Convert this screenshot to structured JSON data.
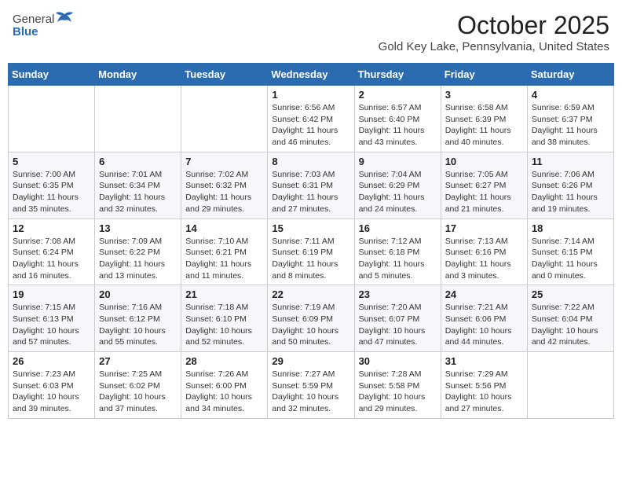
{
  "header": {
    "logo_general": "General",
    "logo_blue": "Blue",
    "month_year": "October 2025",
    "location": "Gold Key Lake, Pennsylvania, United States"
  },
  "days_of_week": [
    "Sunday",
    "Monday",
    "Tuesday",
    "Wednesday",
    "Thursday",
    "Friday",
    "Saturday"
  ],
  "weeks": [
    [
      {
        "day": "",
        "info": ""
      },
      {
        "day": "",
        "info": ""
      },
      {
        "day": "",
        "info": ""
      },
      {
        "day": "1",
        "info": "Sunrise: 6:56 AM\nSunset: 6:42 PM\nDaylight: 11 hours\nand 46 minutes."
      },
      {
        "day": "2",
        "info": "Sunrise: 6:57 AM\nSunset: 6:40 PM\nDaylight: 11 hours\nand 43 minutes."
      },
      {
        "day": "3",
        "info": "Sunrise: 6:58 AM\nSunset: 6:39 PM\nDaylight: 11 hours\nand 40 minutes."
      },
      {
        "day": "4",
        "info": "Sunrise: 6:59 AM\nSunset: 6:37 PM\nDaylight: 11 hours\nand 38 minutes."
      }
    ],
    [
      {
        "day": "5",
        "info": "Sunrise: 7:00 AM\nSunset: 6:35 PM\nDaylight: 11 hours\nand 35 minutes."
      },
      {
        "day": "6",
        "info": "Sunrise: 7:01 AM\nSunset: 6:34 PM\nDaylight: 11 hours\nand 32 minutes."
      },
      {
        "day": "7",
        "info": "Sunrise: 7:02 AM\nSunset: 6:32 PM\nDaylight: 11 hours\nand 29 minutes."
      },
      {
        "day": "8",
        "info": "Sunrise: 7:03 AM\nSunset: 6:31 PM\nDaylight: 11 hours\nand 27 minutes."
      },
      {
        "day": "9",
        "info": "Sunrise: 7:04 AM\nSunset: 6:29 PM\nDaylight: 11 hours\nand 24 minutes."
      },
      {
        "day": "10",
        "info": "Sunrise: 7:05 AM\nSunset: 6:27 PM\nDaylight: 11 hours\nand 21 minutes."
      },
      {
        "day": "11",
        "info": "Sunrise: 7:06 AM\nSunset: 6:26 PM\nDaylight: 11 hours\nand 19 minutes."
      }
    ],
    [
      {
        "day": "12",
        "info": "Sunrise: 7:08 AM\nSunset: 6:24 PM\nDaylight: 11 hours\nand 16 minutes."
      },
      {
        "day": "13",
        "info": "Sunrise: 7:09 AM\nSunset: 6:22 PM\nDaylight: 11 hours\nand 13 minutes."
      },
      {
        "day": "14",
        "info": "Sunrise: 7:10 AM\nSunset: 6:21 PM\nDaylight: 11 hours\nand 11 minutes."
      },
      {
        "day": "15",
        "info": "Sunrise: 7:11 AM\nSunset: 6:19 PM\nDaylight: 11 hours\nand 8 minutes."
      },
      {
        "day": "16",
        "info": "Sunrise: 7:12 AM\nSunset: 6:18 PM\nDaylight: 11 hours\nand 5 minutes."
      },
      {
        "day": "17",
        "info": "Sunrise: 7:13 AM\nSunset: 6:16 PM\nDaylight: 11 hours\nand 3 minutes."
      },
      {
        "day": "18",
        "info": "Sunrise: 7:14 AM\nSunset: 6:15 PM\nDaylight: 11 hours\nand 0 minutes."
      }
    ],
    [
      {
        "day": "19",
        "info": "Sunrise: 7:15 AM\nSunset: 6:13 PM\nDaylight: 10 hours\nand 57 minutes."
      },
      {
        "day": "20",
        "info": "Sunrise: 7:16 AM\nSunset: 6:12 PM\nDaylight: 10 hours\nand 55 minutes."
      },
      {
        "day": "21",
        "info": "Sunrise: 7:18 AM\nSunset: 6:10 PM\nDaylight: 10 hours\nand 52 minutes."
      },
      {
        "day": "22",
        "info": "Sunrise: 7:19 AM\nSunset: 6:09 PM\nDaylight: 10 hours\nand 50 minutes."
      },
      {
        "day": "23",
        "info": "Sunrise: 7:20 AM\nSunset: 6:07 PM\nDaylight: 10 hours\nand 47 minutes."
      },
      {
        "day": "24",
        "info": "Sunrise: 7:21 AM\nSunset: 6:06 PM\nDaylight: 10 hours\nand 44 minutes."
      },
      {
        "day": "25",
        "info": "Sunrise: 7:22 AM\nSunset: 6:04 PM\nDaylight: 10 hours\nand 42 minutes."
      }
    ],
    [
      {
        "day": "26",
        "info": "Sunrise: 7:23 AM\nSunset: 6:03 PM\nDaylight: 10 hours\nand 39 minutes."
      },
      {
        "day": "27",
        "info": "Sunrise: 7:25 AM\nSunset: 6:02 PM\nDaylight: 10 hours\nand 37 minutes."
      },
      {
        "day": "28",
        "info": "Sunrise: 7:26 AM\nSunset: 6:00 PM\nDaylight: 10 hours\nand 34 minutes."
      },
      {
        "day": "29",
        "info": "Sunrise: 7:27 AM\nSunset: 5:59 PM\nDaylight: 10 hours\nand 32 minutes."
      },
      {
        "day": "30",
        "info": "Sunrise: 7:28 AM\nSunset: 5:58 PM\nDaylight: 10 hours\nand 29 minutes."
      },
      {
        "day": "31",
        "info": "Sunrise: 7:29 AM\nSunset: 5:56 PM\nDaylight: 10 hours\nand 27 minutes."
      },
      {
        "day": "",
        "info": ""
      }
    ]
  ]
}
